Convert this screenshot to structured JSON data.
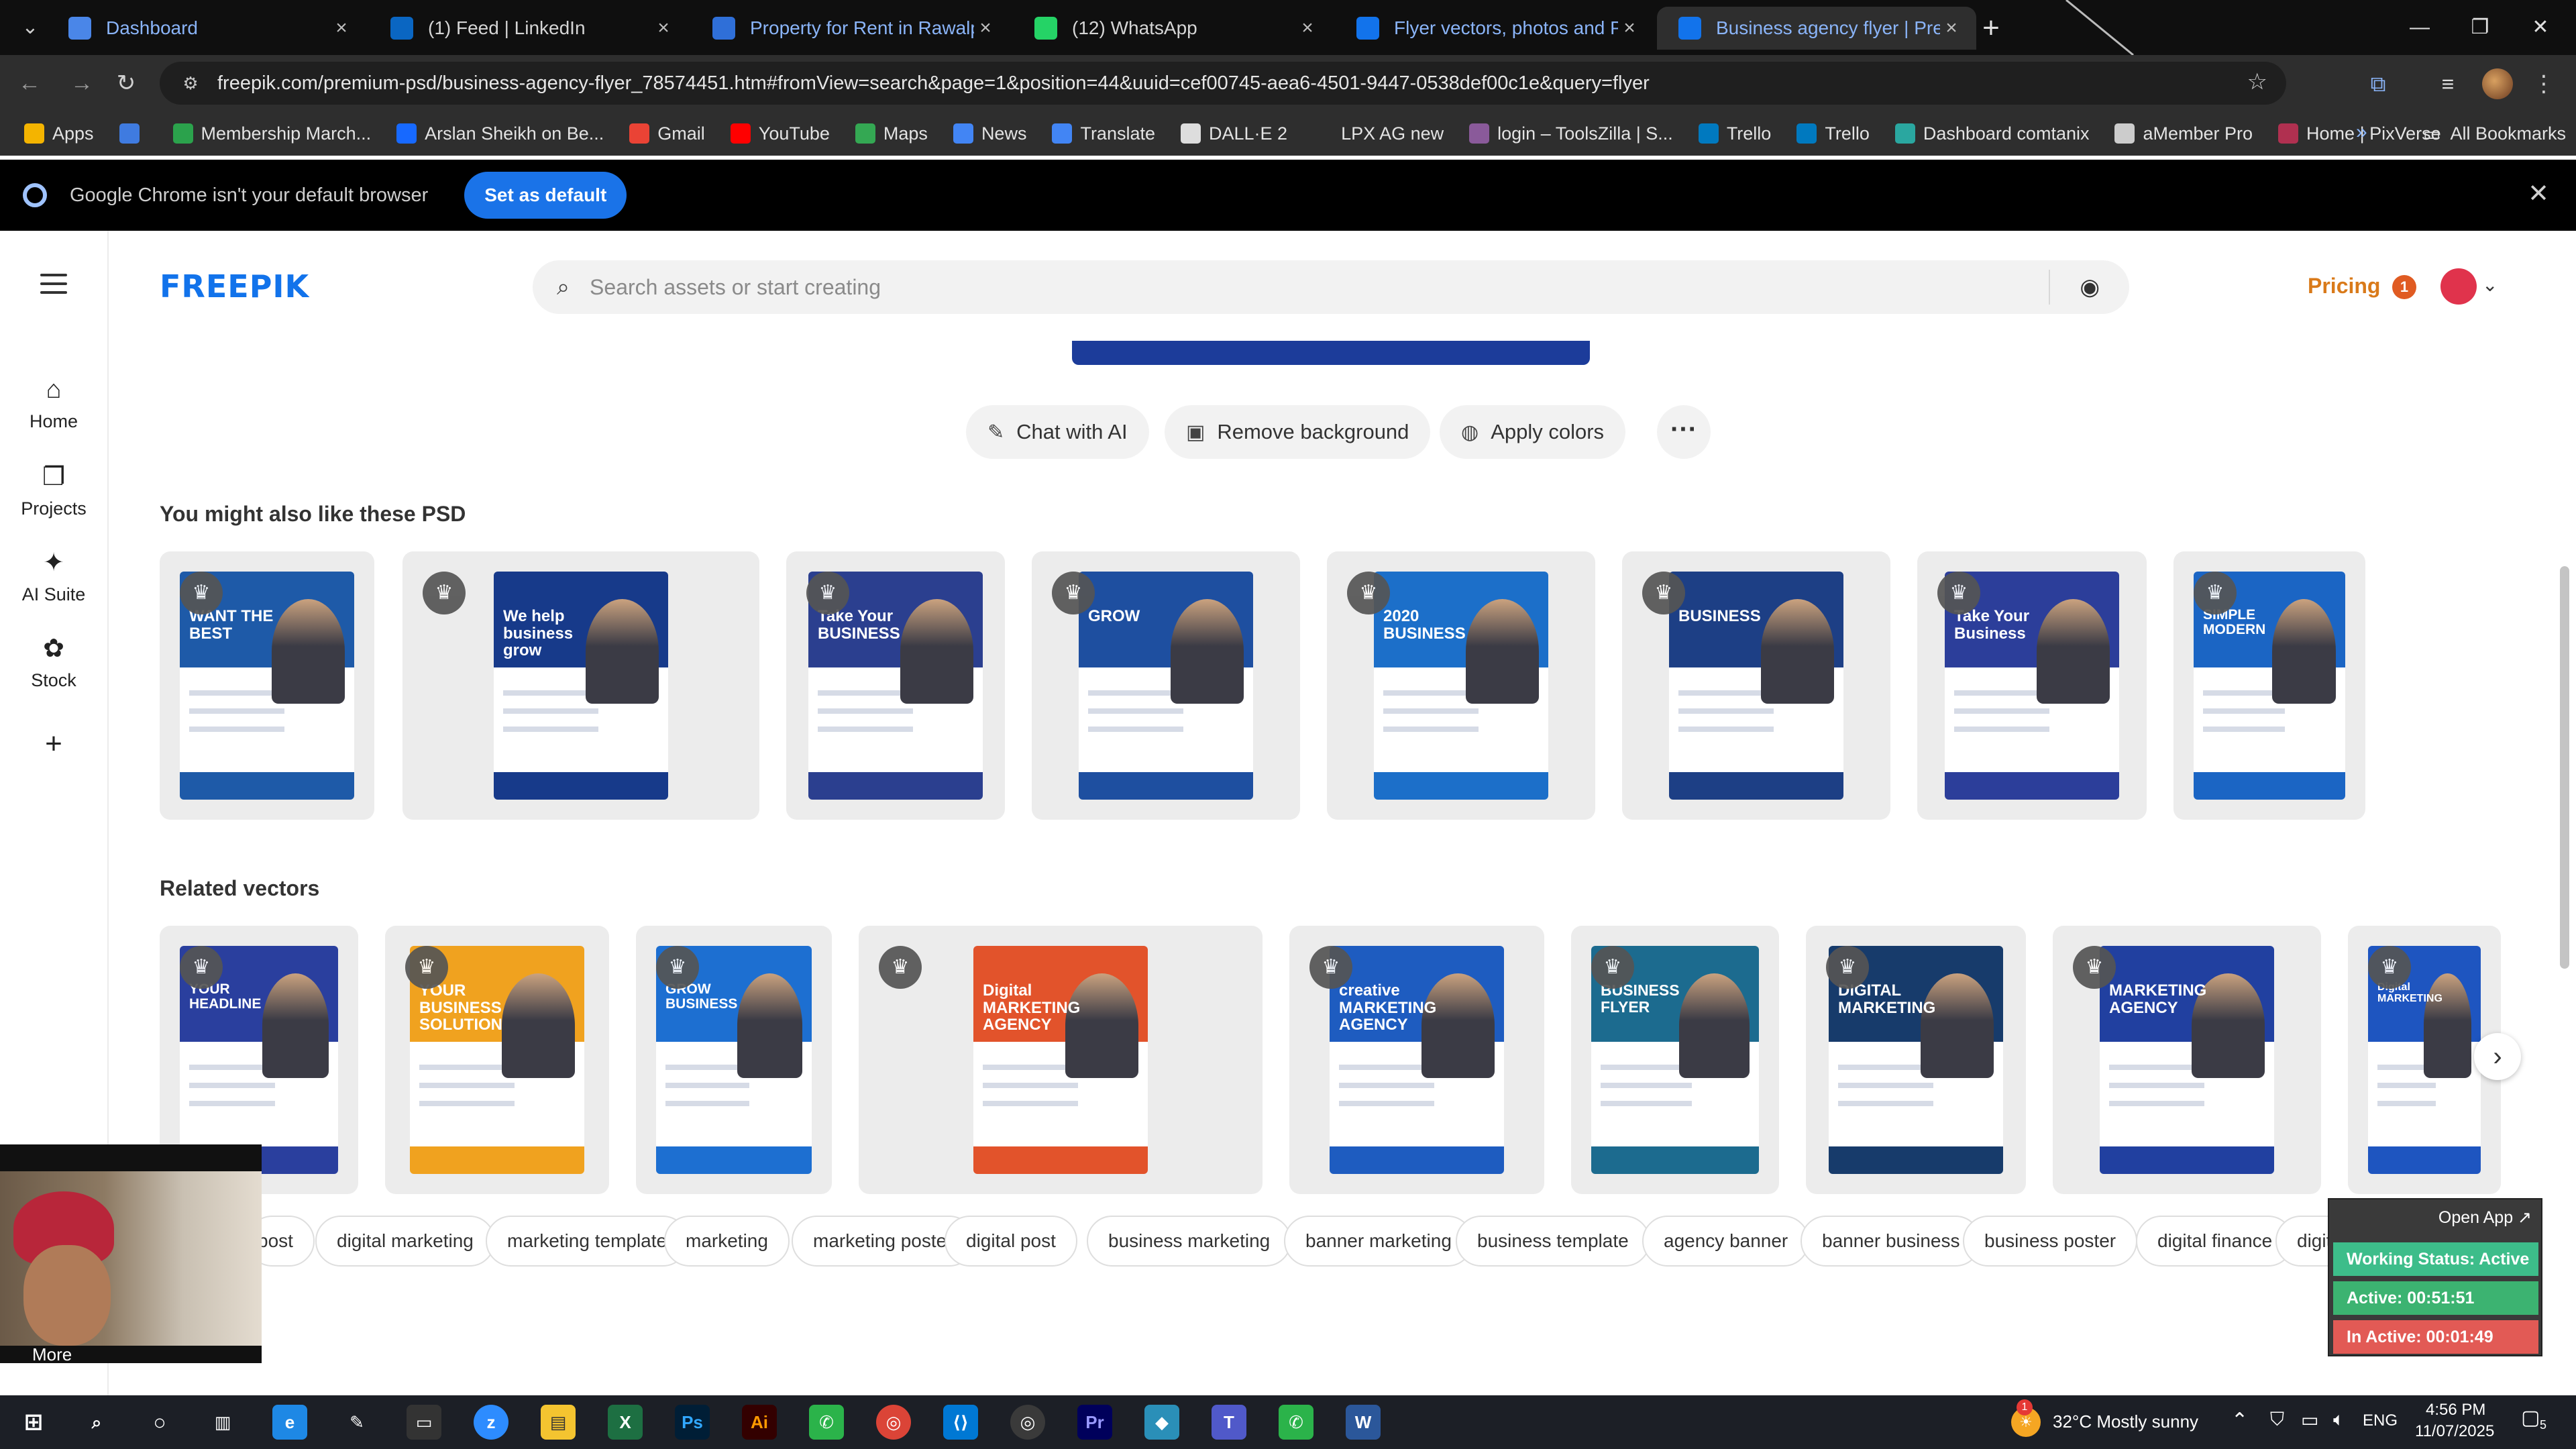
{
  "browser": {
    "tabs": [
      {
        "title": "Dashboard",
        "color": "#4a86e8",
        "icon": "dashboard-icon",
        "linked": true
      },
      {
        "title": "(1) Feed | LinkedIn",
        "color": "#0a66c2",
        "icon": "linkedin-icon",
        "linked": false
      },
      {
        "title": "Property for Rent in Rawalpindi",
        "color": "#2f6fd8",
        "icon": "property-icon",
        "linked": true
      },
      {
        "title": "(12) WhatsApp",
        "color": "#25d366",
        "icon": "whatsapp-icon",
        "linked": false
      },
      {
        "title": "Flyer vectors, photos and PSD f",
        "color": "#1273eb",
        "icon": "freepik-icon",
        "linked": true
      },
      {
        "title": "Business agency flyer | Premium",
        "color": "#1273eb",
        "icon": "freepik-icon",
        "linked": true,
        "active": true
      }
    ],
    "url": "freepik.com/premium-psd/business-agency-flyer_78574451.htm#fromView=search&page=1&position=44&uuid=cef00745-aea6-4501-9447-0538def00c1e&query=flyer",
    "bookmarks": [
      {
        "label": "Apps",
        "color": "#f4b400"
      },
      {
        "label": "",
        "color": "#3f7be0"
      },
      {
        "label": "Membership March...",
        "color": "#2ba24c"
      },
      {
        "label": "Arslan Sheikh on Be...",
        "color": "#1769ff"
      },
      {
        "label": "Gmail",
        "color": "#ea4335"
      },
      {
        "label": "YouTube",
        "color": "#ff0000"
      },
      {
        "label": "Maps",
        "color": "#34a853"
      },
      {
        "label": "News",
        "color": "#4285f4"
      },
      {
        "label": "Translate",
        "color": "#4285f4"
      },
      {
        "label": "DALL·E 2",
        "color": "#dddddd"
      },
      {
        "label": "LPX AG new",
        "color": "#2e2e2e"
      },
      {
        "label": "login – ToolsZilla | S...",
        "color": "#8a5a9a"
      },
      {
        "label": "Trello",
        "color": "#0079bf"
      },
      {
        "label": "Trello",
        "color": "#0079bf"
      },
      {
        "label": "Dashboard comtanix",
        "color": "#2aa7a0"
      },
      {
        "label": "aMember Pro",
        "color": "#cccccc"
      },
      {
        "label": "Home | PixVerse",
        "color": "#b03050"
      }
    ],
    "all_bookmarks": "All Bookmarks",
    "infobar": {
      "message": "Google Chrome isn't your default browser",
      "button": "Set as default"
    }
  },
  "site": {
    "logo": "FREEPIK",
    "search_placeholder": "Search assets or start creating",
    "pricing": "Pricing",
    "notification_count": "1",
    "sidebar": [
      {
        "label": "Home",
        "icon": "home-icon",
        "glyph": "⌂"
      },
      {
        "label": "Projects",
        "icon": "projects-icon",
        "glyph": "❐"
      },
      {
        "label": "AI Suite",
        "icon": "ai-suite-icon",
        "glyph": "✦"
      },
      {
        "label": "Stock",
        "icon": "stock-icon",
        "glyph": "✿"
      }
    ],
    "actions": [
      {
        "label": "Chat with AI",
        "icon": "chat-ai-icon",
        "glyph": "✎"
      },
      {
        "label": "Remove background",
        "icon": "remove-bg-icon",
        "glyph": "▣"
      },
      {
        "label": "Apply colors",
        "icon": "palette-icon",
        "glyph": "◍"
      }
    ],
    "section_psd": "You might also like these PSD",
    "section_vectors": "Related vectors",
    "psd_items": [
      {
        "text": "WANT THE BEST",
        "accent": "#1e5aa8"
      },
      {
        "text": "We help business grow",
        "accent": "#173a8a"
      },
      {
        "text": "Take Your BUSINESS",
        "accent": "#2b3f8f"
      },
      {
        "text": "GROW",
        "accent": "#1e4fa0"
      },
      {
        "text": "2020 BUSINESS",
        "accent": "#1c6fc9"
      },
      {
        "text": "BUSINESS",
        "accent": "#1d3f85"
      },
      {
        "text": "Take Your Business",
        "accent": "#2c3e9a"
      },
      {
        "text": "SIMPLE MODERN",
        "accent": "#1b65c4"
      }
    ],
    "vector_items": [
      {
        "text": "YOUR HEADLINE",
        "accent": "#2a3f9e"
      },
      {
        "text": "YOUR BUSINESS SOLUTION",
        "accent": "#f0a21f"
      },
      {
        "text": "GROW BUSINESS",
        "accent": "#1d6fd1"
      },
      {
        "text": "Digital MARKETING AGENCY",
        "accent": "#e2532b"
      },
      {
        "text": "creative MARKETING AGENCY",
        "accent": "#1e5cc0"
      },
      {
        "text": "BUSINESS FLYER",
        "accent": "#1c6b8f"
      },
      {
        "text": "DIGITAL MARKETING",
        "accent": "#173b6b"
      },
      {
        "text": "MARKETING AGENCY",
        "accent": "#2140a0"
      },
      {
        "text": "Digital MARKETING",
        "accent": "#1e55c0"
      }
    ],
    "tags": [
      "post",
      "digital marketing",
      "marketing template",
      "marketing",
      "marketing poster",
      "digital post",
      "business marketing",
      "banner marketing",
      "business template",
      "agency banner",
      "banner business",
      "business poster",
      "digital finance",
      "digital flyer"
    ]
  },
  "overlay": {
    "video_more": "More",
    "tracker": {
      "open_app": "Open App ↗",
      "status": "Working Status: Active",
      "active": "Active: 00:51:51",
      "inactive": "In Active: 00:01:49"
    }
  },
  "taskbar": {
    "weather": "32°C  Mostly sunny",
    "lang": "ENG",
    "time": "4:56 PM",
    "date": "11/07/2025",
    "weather_alert": "1",
    "notifications": "5"
  }
}
